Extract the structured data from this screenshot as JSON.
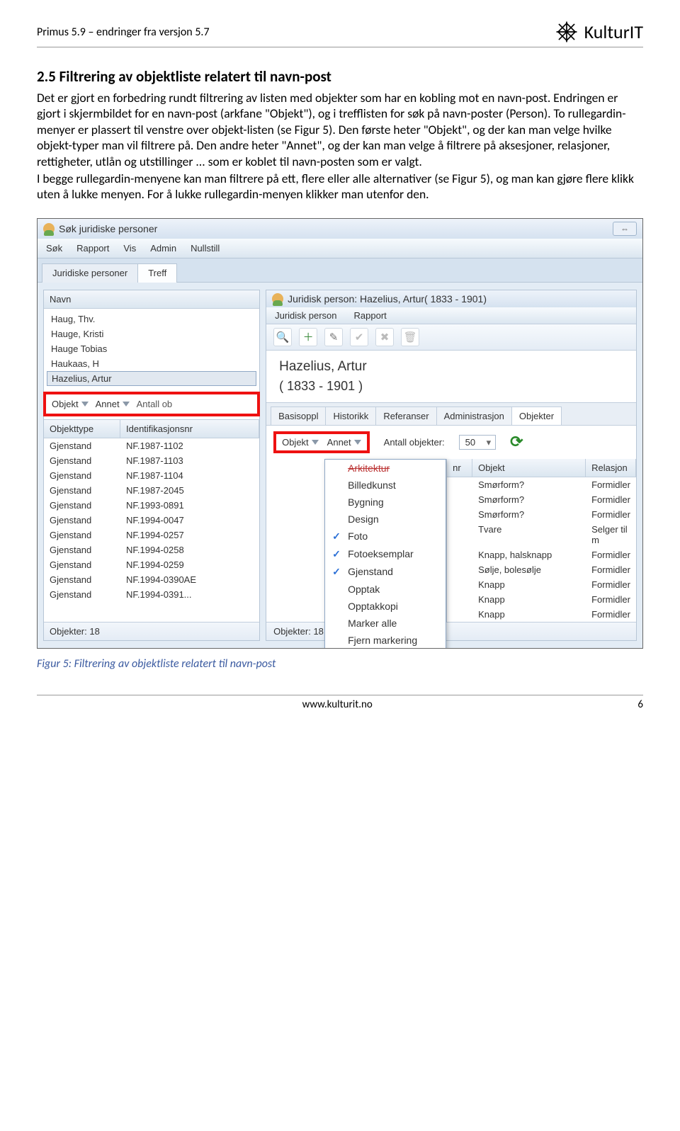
{
  "doc_header": "Primus 5.9 – endringer fra versjon 5.7",
  "brand": "KulturIT",
  "section_heading": "2.5 Filtrering av objektliste relatert til navn-post",
  "para1": "Det er gjort en forbedring rundt filtrering av listen med objekter som har en kobling mot en navn-post. Endringen er gjort i skjermbildet for en navn-post (arkfane \"Objekt\"), og i trefflisten for søk på navn-poster (Person). To rullegardin-menyer er plassert til venstre over objekt-listen (se Figur 5). Den første heter \"Objekt\", og der kan man velge hvilke objekt-typer man vil filtrere på. Den andre heter \"Annet\", og der kan man velge å filtrere på aksesjoner, relasjoner, rettigheter, utlån og utstillinger ... som er koblet til navn-posten som er valgt.",
  "para2": "I begge rullegardin-menyene kan man filtrere på ett, flere eller alle alternativer (se Figur 5), og man kan gjøre flere klikk uten å lukke menyen. For å lukke rullegardin-menyen klikker man utenfor den.",
  "figure_caption": "Figur 5: Filtrering av objektliste relatert til navn-post",
  "footer_url": "www.kulturit.no",
  "page_num": "6",
  "win": {
    "title": "Søk juridiske personer",
    "menu": [
      "Søk",
      "Rapport",
      "Vis",
      "Admin",
      "Nullstill"
    ],
    "outer_tabs": [
      "Juridiske personer",
      "Treff"
    ]
  },
  "left": {
    "head": "Navn",
    "names": [
      "Haug, Thv.",
      "Hauge, Kristi",
      "Hauge Tobias",
      "Haukaas, H",
      "Hazelius, Artur"
    ],
    "filter_objekt": "Objekt",
    "filter_annet": "Annet",
    "filter_antall": "Antall ob",
    "cols": {
      "type": "Objekttype",
      "id": "Identifikasjonsnr"
    },
    "rows": [
      [
        "Gjenstand",
        "NF.1987-1102"
      ],
      [
        "Gjenstand",
        "NF.1987-1103"
      ],
      [
        "Gjenstand",
        "NF.1987-1104"
      ],
      [
        "Gjenstand",
        "NF.1987-2045"
      ],
      [
        "Gjenstand",
        "NF.1993-0891"
      ],
      [
        "Gjenstand",
        "NF.1994-0047"
      ],
      [
        "Gjenstand",
        "NF.1994-0257"
      ],
      [
        "Gjenstand",
        "NF.1994-0258"
      ],
      [
        "Gjenstand",
        "NF.1994-0259"
      ],
      [
        "Gjenstand",
        "NF.1994-0390AE"
      ],
      [
        "Gjenstand",
        "NF.1994-0391..."
      ]
    ],
    "footer": "Objekter: 18"
  },
  "right": {
    "title": "Juridisk person: Hazelius, Artur( 1833 -  1901)",
    "menu": [
      "Juridisk person",
      "Rapport"
    ],
    "big_name": "Hazelius, Artur",
    "big_years": "( 1833 - 1901 )",
    "inner_tabs": [
      "Basisoppl",
      "Historikk",
      "Referanser",
      "Administrasjon",
      "Objekter"
    ],
    "filter_objekt": "Objekt",
    "filter_annet": "Annet",
    "antall_label": "Antall objekter:",
    "antall_value": "50",
    "dropdown_first_strike": "Arkitektur",
    "dropdown": [
      {
        "check": false,
        "label": "Billedkunst"
      },
      {
        "check": false,
        "label": "Bygning"
      },
      {
        "check": false,
        "label": "Design"
      },
      {
        "check": true,
        "label": "Foto"
      },
      {
        "check": true,
        "label": "Fotoeksemplar"
      },
      {
        "check": true,
        "label": "Gjenstand"
      },
      {
        "check": false,
        "label": "Opptak"
      },
      {
        "check": false,
        "label": "Opptakkopi"
      },
      {
        "check": false,
        "label": "Marker alle"
      },
      {
        "check": false,
        "label": "Fjern markering"
      }
    ],
    "table_head": {
      "nr": "nr",
      "obj": "Objekt",
      "rel": "Relasjon"
    },
    "table_rows": [
      [
        "Smørform?",
        "Formidler"
      ],
      [
        "Smørform?",
        "Formidler"
      ],
      [
        "Smørform?",
        "Formidler"
      ],
      [
        "Tvare",
        "Selger til m"
      ],
      [
        "Knapp, halsknapp",
        "Formidler"
      ],
      [
        "Sølje, bolesølje",
        "Formidler"
      ],
      [
        "Knapp",
        "Formidler"
      ],
      [
        "Knapp",
        "Formidler"
      ],
      [
        "Knapp",
        "Formidler"
      ]
    ],
    "footer": "Objekter: 18"
  }
}
